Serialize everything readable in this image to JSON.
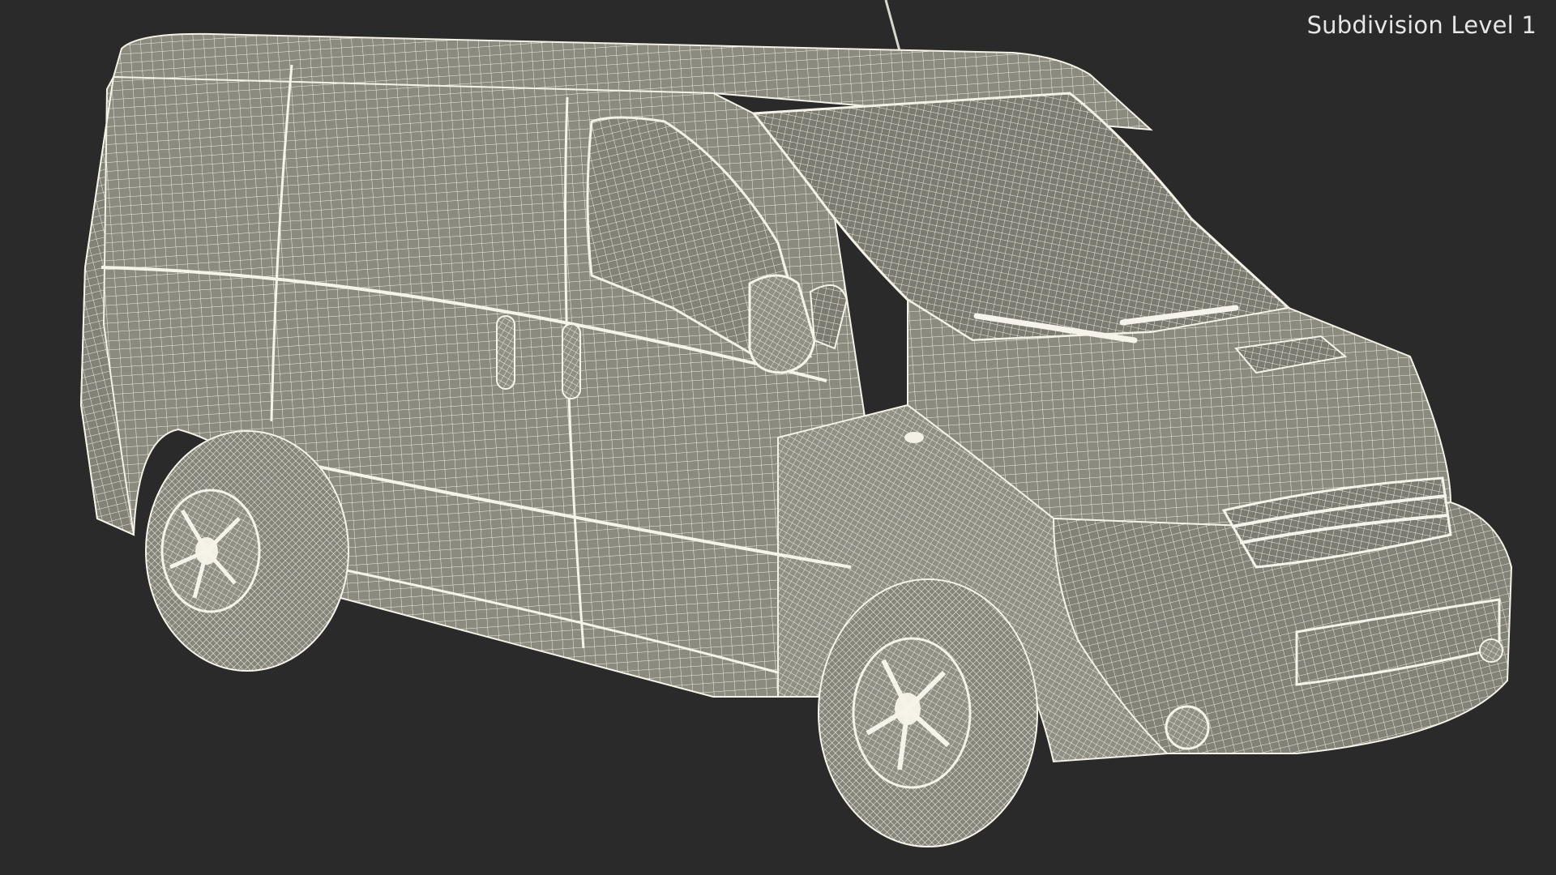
{
  "viewport": {
    "subdivision_label": "Subdivision Level 1",
    "background_color": "#2a2a2a"
  },
  "model": {
    "subject": "van-wireframe",
    "surface_color": "#8a8a80",
    "wire_color": "#f0eee2"
  }
}
